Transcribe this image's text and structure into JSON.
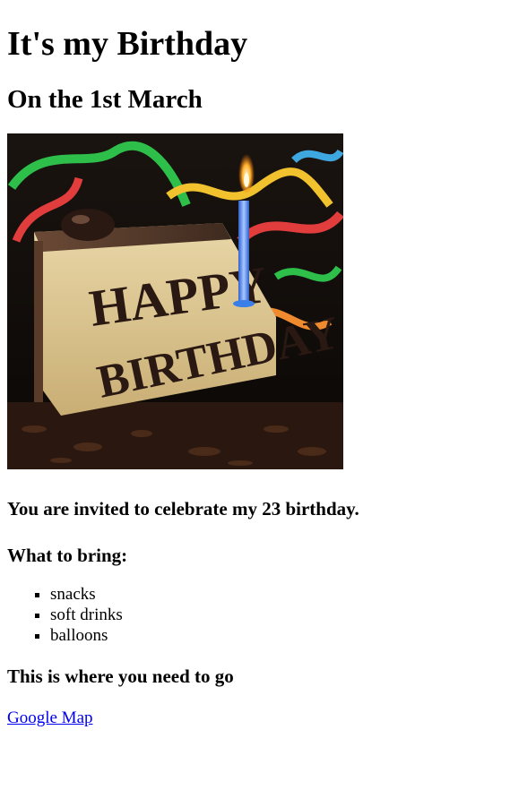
{
  "page": {
    "title": "It's my Birthday",
    "date_heading": "On the 1st March",
    "image": {
      "alt": "Birthday cake slice with lit candle and the words HAPPY BIRTHDAY",
      "cake_text_line1": "HAPPY",
      "cake_text_line2": "BIRTHDAY"
    },
    "invitation": "You are invited to celebrate my 23 birthday.",
    "bring_heading": "What to bring:",
    "bring_items": [
      "snacks",
      "soft drinks",
      "balloons"
    ],
    "directions_heading": "This is where you need to go",
    "map_link": "Google Map"
  },
  "colors": {
    "link": "#0000ee",
    "text": "#000000",
    "background": "#ffffff"
  }
}
